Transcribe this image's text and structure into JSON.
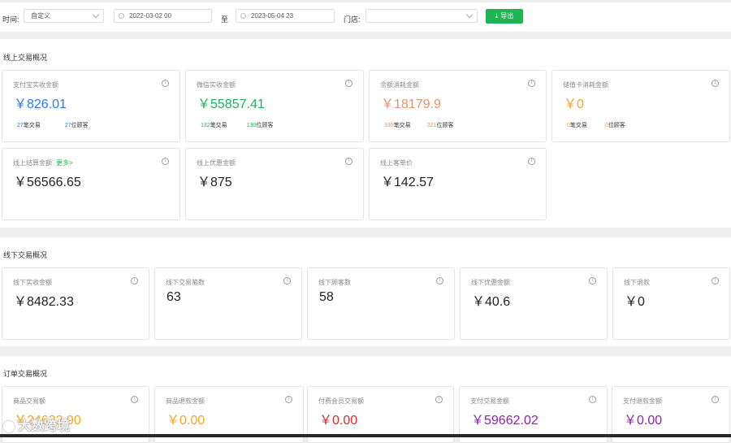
{
  "filter": {
    "time_label": "时间:",
    "time_select": "自定义",
    "start_date": "2022-03-02 00",
    "to_label": "至",
    "end_date": "2023-05-04 23",
    "store_label": "门店:",
    "store_select": "",
    "export_label": "导出"
  },
  "colors": {
    "blue": "#2c7be5",
    "green": "#1fb356",
    "salmon": "#e8916b",
    "orange": "#f5a623",
    "red": "#d0302f",
    "purple": "#8e24aa",
    "dark": "#222222"
  },
  "online": {
    "title": "线上交易概况",
    "cards": [
      {
        "label": "支付宝实收金额",
        "value": "￥826.01",
        "color": "blue",
        "tx": "27",
        "tx_unit": "笔交易",
        "cust": "27",
        "cust_unit": "位顾客"
      },
      {
        "label": "微信实收金额",
        "value": "￥55857.41",
        "color": "green",
        "tx": "132",
        "tx_unit": "笔交易",
        "cust": "130",
        "cust_unit": "位顾客"
      },
      {
        "label": "余额消耗金额",
        "value": "￥18179.9",
        "color": "salmon",
        "tx": "339",
        "tx_unit": "笔交易",
        "cust": "321",
        "cust_unit": "位顾客"
      },
      {
        "label": "储值卡消耗金额",
        "value": "￥0",
        "color": "orange",
        "tx": "0",
        "tx_unit": "笔交易",
        "cust": "0",
        "cust_unit": "位顾客"
      },
      {
        "label": "线上结算金额",
        "more": "更多>",
        "value": "￥56566.65",
        "color": "dark"
      },
      {
        "label": "线上优惠金额",
        "value": "￥875",
        "color": "dark"
      },
      {
        "label": "线上客单价",
        "value": "￥142.57",
        "color": "dark"
      }
    ]
  },
  "offline": {
    "title": "线下交易概况",
    "cards": [
      {
        "label": "线下实收金额",
        "value": "￥8482.33"
      },
      {
        "label": "线下交易笔数",
        "value": "63"
      },
      {
        "label": "线下顾客数",
        "value": "58"
      },
      {
        "label": "线下优惠金额",
        "value": "￥40.6"
      },
      {
        "label": "线下退款",
        "value": "￥0"
      }
    ]
  },
  "order": {
    "title": "订单交易概况",
    "cards": [
      {
        "label": "商品交易额",
        "value": "￥24632.90",
        "color": "orange"
      },
      {
        "label": "商品退款金额",
        "value": "￥0.00",
        "color": "orange"
      },
      {
        "label": "付费会员交易额",
        "value": "￥0.00",
        "color": "red"
      },
      {
        "label": "支付交易金额",
        "value": "￥59662.02",
        "color": "purple"
      },
      {
        "label": "支付退款金额",
        "value": "￥0.00",
        "color": "purple"
      }
    ]
  },
  "watermark": "大数跨境"
}
